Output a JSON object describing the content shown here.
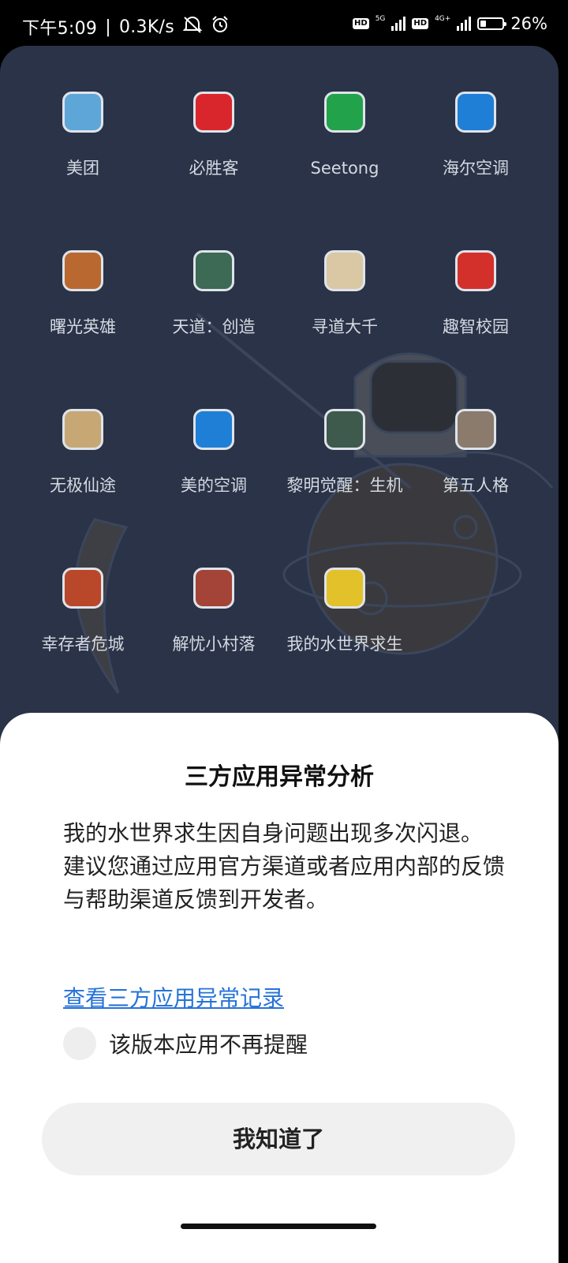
{
  "status_bar": {
    "time": "下午5:09",
    "separator": "|",
    "speed": "0.3K/s",
    "network1": "5G",
    "network2": "4G+",
    "hd1": "HD",
    "hd2": "HD",
    "battery": "26%",
    "battery_level": 0.26,
    "icons": [
      "mute-icon",
      "alarm-icon",
      "signal-icon",
      "battery-icon"
    ]
  },
  "folder": {
    "apps": [
      {
        "label": "美团",
        "icon": "meituan-icon",
        "color": "#5ea6d8"
      },
      {
        "label": "必胜客",
        "icon": "pizzahut-icon",
        "color": "#d9262c"
      },
      {
        "label": "Seetong",
        "icon": "seetong-icon",
        "color": "#22a24a"
      },
      {
        "label": "海尔空调",
        "icon": "haier-ac-icon",
        "color": "#1f7fd6"
      },
      {
        "label": "曙光英雄",
        "icon": "shuguang-icon",
        "color": "#b9692f"
      },
      {
        "label": "天道：创造",
        "icon": "tiandao-icon",
        "color": "#3c6a55"
      },
      {
        "label": "寻道大千",
        "icon": "xundao-icon",
        "color": "#d9c8a3"
      },
      {
        "label": "趣智校园",
        "icon": "quzhi-icon",
        "color": "#d3302b"
      },
      {
        "label": "无极仙途",
        "icon": "wuji-icon",
        "color": "#c7a774"
      },
      {
        "label": "美的空调",
        "icon": "midea-ac-icon",
        "color": "#1f7fd6"
      },
      {
        "label": "黎明觉醒：生机",
        "icon": "liming-icon",
        "color": "#3d5a4c"
      },
      {
        "label": "第五人格",
        "icon": "identity-icon",
        "color": "#8a7b6c"
      },
      {
        "label": "幸存者危城",
        "icon": "survivor-icon",
        "color": "#b9472a"
      },
      {
        "label": "解忧小村落",
        "icon": "jieyou-icon",
        "color": "#a44338"
      },
      {
        "label": "我的水世界求生",
        "icon": "water-world-icon",
        "color": "#e2c12a"
      }
    ]
  },
  "dialog": {
    "title": "三方应用异常分析",
    "body_line1": "我的水世界求生因自身问题出现多次闪退。",
    "body_line2": "建议您通过应用官方渠道或者应用内部的反馈与帮助渠道反馈到开发者。",
    "link": "查看三方应用异常记录",
    "checkbox_label": "该版本应用不再提醒",
    "checkbox_checked": false,
    "button": "我知道了"
  }
}
